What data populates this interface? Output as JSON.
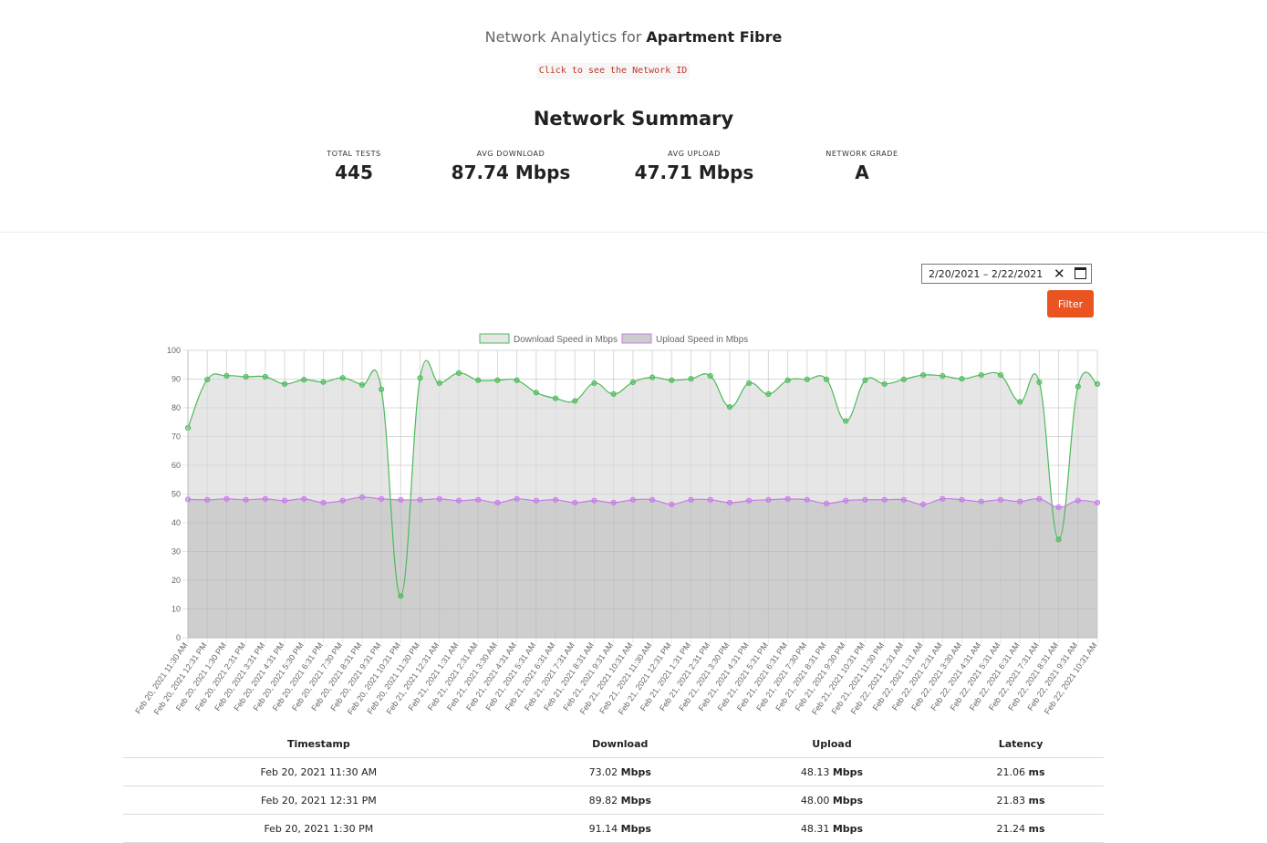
{
  "header": {
    "title_prefix": "Network Analytics for",
    "network_name": "Apartment Fibre",
    "network_id_link": "Click to see the Network ID",
    "summary_title": "Network Summary"
  },
  "stats": [
    {
      "label": "TOTAL TESTS",
      "value": "445"
    },
    {
      "label": "AVG DOWNLOAD",
      "value": "87.74 Mbps"
    },
    {
      "label": "AVG UPLOAD",
      "value": "47.71 Mbps"
    },
    {
      "label": "NETWORK GRADE",
      "value": "A"
    }
  ],
  "filter": {
    "date_range": "2/20/2021 –  2/22/2021",
    "clear_icon": "close-icon",
    "calendar_icon": "calendar-icon",
    "button_label": "Filter",
    "button_color": "#ea5421"
  },
  "chart_data": {
    "type": "line",
    "ylim": [
      0,
      100
    ],
    "yticks": [
      0,
      10,
      20,
      30,
      40,
      50,
      60,
      70,
      80,
      90,
      100
    ],
    "grid": true,
    "legend_position": "top",
    "categories": [
      "Feb 20, 2021 11:30 AM",
      "Feb 20, 2021 12:31 PM",
      "Feb 20, 2021 1:30 PM",
      "Feb 20, 2021 2:31 PM",
      "Feb 20, 2021 3:31 PM",
      "Feb 20, 2021 4:31 PM",
      "Feb 20, 2021 5:30 PM",
      "Feb 20, 2021 6:31 PM",
      "Feb 20, 2021 7:30 PM",
      "Feb 20, 2021 8:31 PM",
      "Feb 20, 2021 9:31 PM",
      "Feb 20, 2021 10:31 PM",
      "Feb 20, 2021 11:30 PM",
      "Feb 21, 2021 12:31 AM",
      "Feb 21, 2021 1:31 AM",
      "Feb 21, 2021 2:31 AM",
      "Feb 21, 2021 3:30 AM",
      "Feb 21, 2021 4:31 AM",
      "Feb 21, 2021 5:31 AM",
      "Feb 21, 2021 6:31 AM",
      "Feb 21, 2021 7:31 AM",
      "Feb 21, 2021 8:31 AM",
      "Feb 21, 2021 9:31 AM",
      "Feb 21, 2021 10:31 AM",
      "Feb 21, 2021 11:30 AM",
      "Feb 21, 2021 12:31 PM",
      "Feb 21, 2021 1:31 PM",
      "Feb 21, 2021 2:31 PM",
      "Feb 21, 2021 3:30 PM",
      "Feb 21, 2021 4:31 PM",
      "Feb 21, 2021 5:31 PM",
      "Feb 21, 2021 6:31 PM",
      "Feb 21, 2021 7:30 PM",
      "Feb 21, 2021 8:31 PM",
      "Feb 21, 2021 9:30 PM",
      "Feb 21, 2021 10:31 PM",
      "Feb 21, 2021 11:30 PM",
      "Feb 22, 2021 12:31 AM",
      "Feb 22, 2021 1:31 AM",
      "Feb 22, 2021 2:31 AM",
      "Feb 22, 2021 3:30 AM",
      "Feb 22, 2021 4:31 AM",
      "Feb 22, 2021 5:31 AM",
      "Feb 22, 2021 6:31 AM",
      "Feb 22, 2021 7:31 AM",
      "Feb 22, 2021 8:31 AM",
      "Feb 22, 2021 9:31 AM",
      "Feb 22, 2021 10:31 AM"
    ],
    "series": [
      {
        "name": "Download Speed in Mbps",
        "line_color": "#4cbb5a",
        "fill_color": "#e6e6e6",
        "values": [
          73.02,
          89.82,
          91.14,
          90.8,
          90.8,
          88.3,
          89.8,
          89.0,
          90.4,
          88.0,
          86.4,
          14.5,
          90.4,
          88.6,
          92.1,
          89.6,
          89.6,
          89.6,
          85.3,
          83.3,
          82.4,
          88.6,
          84.8,
          88.9,
          90.6,
          89.6,
          90.1,
          91.1,
          80.3,
          88.6,
          84.8,
          89.6,
          89.9,
          89.9,
          75.4,
          89.6,
          88.3,
          89.9,
          91.4,
          91.1,
          90.1,
          91.4,
          91.4,
          82.1,
          88.9,
          34.2,
          87.4,
          88.3
        ]
      },
      {
        "name": "Upload Speed in Mbps",
        "line_color": "#c77bea",
        "fill_color": "#cccccc",
        "values": [
          48.13,
          48.0,
          48.31,
          48.0,
          48.3,
          47.7,
          48.3,
          47.0,
          47.7,
          48.9,
          48.3,
          48.0,
          48.0,
          48.3,
          47.7,
          48.0,
          47.0,
          48.3,
          47.7,
          48.0,
          47.0,
          47.7,
          47.0,
          48.0,
          48.0,
          46.4,
          48.0,
          48.0,
          47.0,
          47.7,
          48.0,
          48.3,
          48.0,
          46.7,
          47.7,
          48.0,
          48.0,
          48.0,
          46.4,
          48.3,
          48.0,
          47.4,
          48.0,
          47.4,
          48.3,
          45.4,
          47.7,
          47.0
        ]
      }
    ]
  },
  "table": {
    "headers": [
      "Timestamp",
      "Download",
      "Upload",
      "Latency"
    ],
    "rows": [
      {
        "timestamp": "Feb 20, 2021 11:30 AM",
        "download": "73.02",
        "download_unit": "Mbps",
        "upload": "48.13",
        "upload_unit": "Mbps",
        "latency": "21.06",
        "latency_unit": "ms"
      },
      {
        "timestamp": "Feb 20, 2021 12:31 PM",
        "download": "89.82",
        "download_unit": "Mbps",
        "upload": "48.00",
        "upload_unit": "Mbps",
        "latency": "21.83",
        "latency_unit": "ms"
      },
      {
        "timestamp": "Feb 20, 2021 1:30 PM",
        "download": "91.14",
        "download_unit": "Mbps",
        "upload": "48.31",
        "upload_unit": "Mbps",
        "latency": "21.24",
        "latency_unit": "ms"
      }
    ]
  }
}
